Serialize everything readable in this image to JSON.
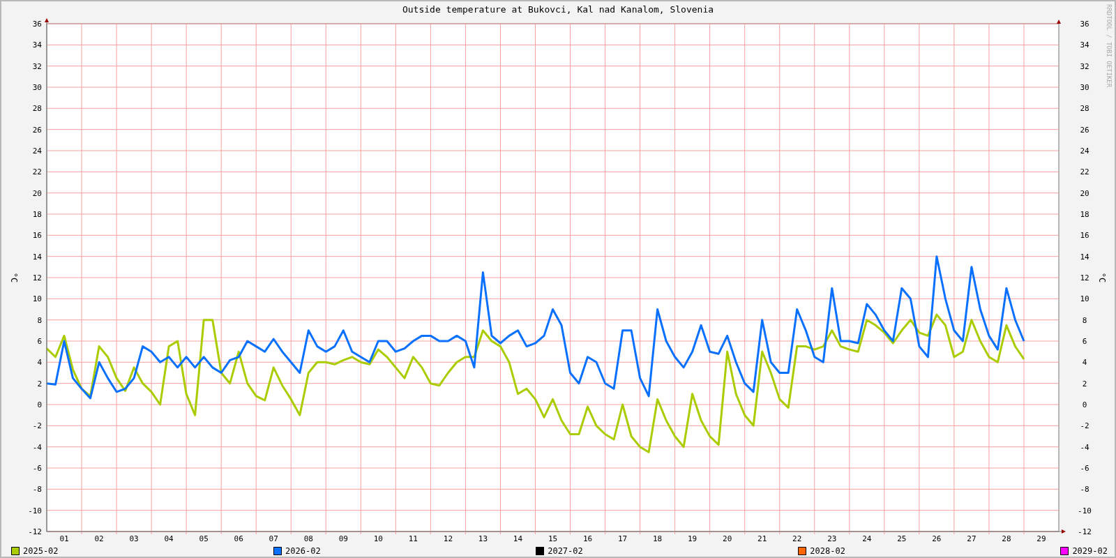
{
  "title": "Outside temperature at Bukovci, Kal nad Kanalom, Slovenia",
  "credit": "RRDTOOL / TOBI OETIKER",
  "y_axis_label_left": "°C",
  "y_axis_label_right": "°C",
  "right_axis_ticks": [
    "36",
    "34",
    "32",
    "30",
    "28",
    "26",
    "24",
    "22",
    "20",
    "18",
    "16",
    "14",
    "12",
    "10",
    "8",
    "6",
    "4",
    "2",
    "0",
    "-2",
    "-4",
    "-6",
    "-8",
    "-10",
    "-12"
  ],
  "chart_data": {
    "type": "line",
    "grid": true,
    "xlim": [
      0,
      29
    ],
    "ylim": [
      -12,
      36
    ],
    "yticks": [
      {
        "value": -12,
        "label": "-12"
      },
      {
        "value": -10,
        "label": "-10"
      },
      {
        "value": -8,
        "label": "-8"
      },
      {
        "value": -6,
        "label": "-6"
      },
      {
        "value": -4,
        "label": "-4"
      },
      {
        "value": -2,
        "label": "-2"
      },
      {
        "value": 0,
        "label": "0"
      },
      {
        "value": 2,
        "label": "2"
      },
      {
        "value": 4,
        "label": "4"
      },
      {
        "value": 6,
        "label": "6"
      },
      {
        "value": 8,
        "label": "8"
      },
      {
        "value": 10,
        "label": "10"
      },
      {
        "value": 12,
        "label": "12"
      },
      {
        "value": 14,
        "label": "14"
      },
      {
        "value": 16,
        "label": "16"
      },
      {
        "value": 18,
        "label": "18"
      },
      {
        "value": 20,
        "label": "20"
      },
      {
        "value": 22,
        "label": "22"
      },
      {
        "value": 24,
        "label": "24"
      },
      {
        "value": 26,
        "label": "26"
      },
      {
        "value": 28,
        "label": "28"
      },
      {
        "value": 30,
        "label": "30"
      },
      {
        "value": 32,
        "label": "32"
      },
      {
        "value": 34,
        "label": "34"
      },
      {
        "value": 36,
        "label": "36"
      }
    ],
    "xticks": [
      {
        "value": 0.5,
        "label": "01"
      },
      {
        "value": 1.5,
        "label": "02"
      },
      {
        "value": 2.5,
        "label": "03"
      },
      {
        "value": 3.5,
        "label": "04"
      },
      {
        "value": 4.5,
        "label": "05"
      },
      {
        "value": 5.5,
        "label": "06"
      },
      {
        "value": 6.5,
        "label": "07"
      },
      {
        "value": 7.5,
        "label": "08"
      },
      {
        "value": 8.5,
        "label": "09"
      },
      {
        "value": 9.5,
        "label": "10"
      },
      {
        "value": 10.5,
        "label": "11"
      },
      {
        "value": 11.5,
        "label": "12"
      },
      {
        "value": 12.5,
        "label": "13"
      },
      {
        "value": 13.5,
        "label": "14"
      },
      {
        "value": 14.5,
        "label": "15"
      },
      {
        "value": 15.5,
        "label": "16"
      },
      {
        "value": 16.5,
        "label": "17"
      },
      {
        "value": 17.5,
        "label": "18"
      },
      {
        "value": 18.5,
        "label": "19"
      },
      {
        "value": 19.5,
        "label": "20"
      },
      {
        "value": 20.5,
        "label": "21"
      },
      {
        "value": 21.5,
        "label": "22"
      },
      {
        "value": 22.5,
        "label": "23"
      },
      {
        "value": 23.5,
        "label": "24"
      },
      {
        "value": 24.5,
        "label": "25"
      },
      {
        "value": 25.5,
        "label": "26"
      },
      {
        "value": 26.5,
        "label": "27"
      },
      {
        "value": 27.5,
        "label": "28"
      },
      {
        "value": 28.5,
        "label": "29"
      }
    ],
    "x": [
      0,
      0.25,
      0.5,
      0.75,
      1,
      1.25,
      1.5,
      1.75,
      2,
      2.25,
      2.5,
      2.75,
      3,
      3.25,
      3.5,
      3.75,
      4,
      4.25,
      4.5,
      4.75,
      5,
      5.25,
      5.5,
      5.75,
      6,
      6.25,
      6.5,
      6.75,
      7,
      7.25,
      7.5,
      7.75,
      8,
      8.25,
      8.5,
      8.75,
      9,
      9.25,
      9.5,
      9.75,
      10,
      10.25,
      10.5,
      10.75,
      11,
      11.25,
      11.5,
      11.75,
      12,
      12.25,
      12.5,
      12.75,
      13,
      13.25,
      13.5,
      13.75,
      14,
      14.25,
      14.5,
      14.75,
      15,
      15.25,
      15.5,
      15.75,
      16,
      16.25,
      16.5,
      16.75,
      17,
      17.25,
      17.5,
      17.75,
      18,
      18.25,
      18.5,
      18.75,
      19,
      19.25,
      19.5,
      19.75,
      20,
      20.25,
      20.5,
      20.75,
      21,
      21.25,
      21.5,
      21.75,
      22,
      22.25,
      22.5,
      22.75,
      23,
      23.25,
      23.5,
      23.75,
      24,
      24.25,
      24.5,
      24.75,
      25,
      25.25,
      25.5,
      25.75,
      26,
      26.25,
      26.5,
      26.75,
      27,
      27.25,
      27.5,
      27.75,
      28
    ],
    "series": [
      {
        "name": "2025-02",
        "color": "#aacc00",
        "values": [
          5.3,
          4.5,
          6.5,
          3.3,
          1.5,
          0.8,
          5.5,
          4.5,
          2.5,
          1.3,
          3.5,
          2.0,
          1.2,
          0.0,
          5.5,
          6.0,
          1.0,
          -1.0,
          8.0,
          8.0,
          3.0,
          2.0,
          5.0,
          2.0,
          0.8,
          0.4,
          3.5,
          1.8,
          0.5,
          -1.0,
          3.0,
          4.0,
          4.0,
          3.8,
          4.2,
          4.5,
          4.0,
          3.8,
          5.2,
          4.5,
          3.5,
          2.5,
          4.5,
          3.5,
          2.0,
          1.8,
          3.0,
          4.0,
          4.5,
          4.5,
          7.0,
          6.0,
          5.5,
          4.0,
          1.0,
          1.5,
          0.5,
          -1.2,
          0.5,
          -1.5,
          -2.8,
          -2.8,
          -0.2,
          -2.0,
          -2.8,
          -3.3,
          0.0,
          -3.0,
          -4.0,
          -4.5,
          0.5,
          -1.5,
          -3.0,
          -4.0,
          1.0,
          -1.5,
          -3.0,
          -3.8,
          5.0,
          1.0,
          -1.0,
          -2.0,
          5.0,
          3.0,
          0.5,
          -0.3,
          5.5,
          5.5,
          5.2,
          5.5,
          7.0,
          5.5,
          5.2,
          5.0,
          8.0,
          7.5,
          6.8,
          5.8,
          7.0,
          8.0,
          6.8,
          6.5,
          8.5,
          7.5,
          4.5,
          5.0,
          8.0,
          6.0,
          4.5,
          4.0,
          7.5,
          5.5,
          4.3
        ]
      },
      {
        "name": "2026-02",
        "color": "#0a70ff",
        "values": [
          2.0,
          1.9,
          6.0,
          2.5,
          1.5,
          0.6,
          4.0,
          2.5,
          1.2,
          1.5,
          2.5,
          5.5,
          5.0,
          4.0,
          4.5,
          3.5,
          4.5,
          3.5,
          4.5,
          3.5,
          3.0,
          4.2,
          4.5,
          6.0,
          5.5,
          5.0,
          6.2,
          5.0,
          4.0,
          3.0,
          7.0,
          5.5,
          5.0,
          5.5,
          7.0,
          5.0,
          4.5,
          4.0,
          6.0,
          6.0,
          5.0,
          5.3,
          6.0,
          6.5,
          6.5,
          6.0,
          6.0,
          6.5,
          6.0,
          3.5,
          12.5,
          6.5,
          5.8,
          6.5,
          7.0,
          5.5,
          5.8,
          6.5,
          9.0,
          7.5,
          3.0,
          2.0,
          4.5,
          4.0,
          2.0,
          1.5,
          7.0,
          7.0,
          2.5,
          0.8,
          9.0,
          6.0,
          4.5,
          3.5,
          5.0,
          7.5,
          5.0,
          4.8,
          6.5,
          4.0,
          2.0,
          1.2,
          8.0,
          4.0,
          3.0,
          3.0,
          9.0,
          7.0,
          4.5,
          4.0,
          11.0,
          6.0,
          6.0,
          5.8,
          9.5,
          8.5,
          7.0,
          6.0,
          11.0,
          10.0,
          5.5,
          4.5,
          14.0,
          10.0,
          7.0,
          6.0,
          13.0,
          9.0,
          6.5,
          5.2,
          11.0,
          8.0,
          6.0
        ]
      }
    ]
  },
  "legend_extra": [
    {
      "label": "2027-02",
      "color": "#000000"
    },
    {
      "label": "2028-02",
      "color": "#ff6600"
    },
    {
      "label": "2029-02",
      "color": "#ff00ff"
    }
  ]
}
